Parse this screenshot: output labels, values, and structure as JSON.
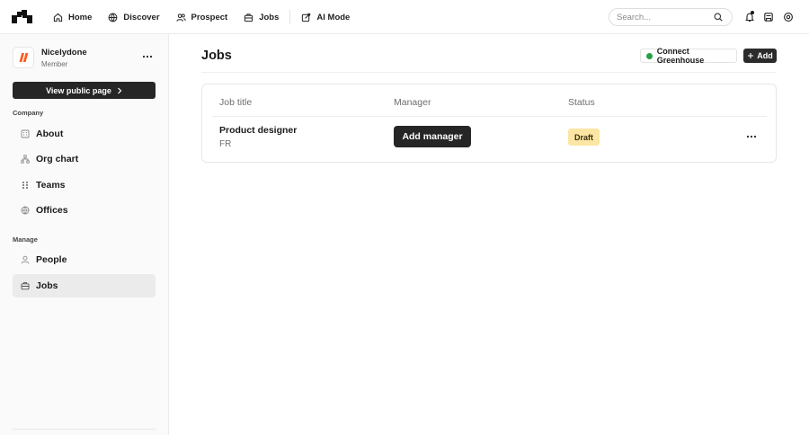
{
  "topbar": {
    "nav": [
      {
        "label": "Home",
        "icon": "home-icon"
      },
      {
        "label": "Discover",
        "icon": "globe-icon"
      },
      {
        "label": "Prospect",
        "icon": "users-icon"
      },
      {
        "label": "Jobs",
        "icon": "briefcase-icon"
      },
      {
        "label": "AI Mode",
        "icon": "ai-mode-icon"
      }
    ],
    "search_placeholder": "Search..."
  },
  "sidebar": {
    "org_name": "Nicelydone",
    "org_role": "Member",
    "public_page_label": "View public page",
    "sections": [
      {
        "label": "Company",
        "items": [
          {
            "label": "About",
            "icon": "building-icon"
          },
          {
            "label": "Org chart",
            "icon": "org-chart-icon"
          },
          {
            "label": "Teams",
            "icon": "teams-icon"
          },
          {
            "label": "Offices",
            "icon": "globe-icon"
          }
        ]
      },
      {
        "label": "Manage",
        "items": [
          {
            "label": "People",
            "icon": "person-icon"
          },
          {
            "label": "Jobs",
            "icon": "briefcase-icon",
            "active": true
          }
        ]
      }
    ]
  },
  "main": {
    "title": "Jobs",
    "connect_label": "Connect Greenhouse",
    "add_label": "Add",
    "table": {
      "headers": [
        "Job title",
        "Manager",
        "Status"
      ],
      "rows": [
        {
          "title": "Product designer",
          "location": "FR",
          "manager_action": "Add manager",
          "status": "Draft"
        }
      ]
    }
  },
  "colors": {
    "accent_dark": "#262626",
    "status_draft_bg": "#fbe6a3",
    "greenhouse_green": "#24a148"
  }
}
